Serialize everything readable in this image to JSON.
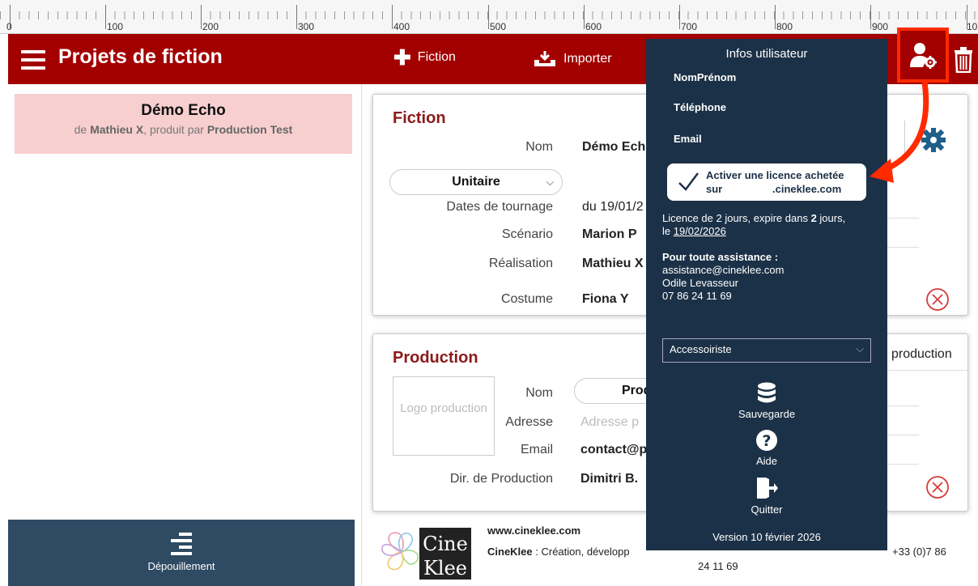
{
  "ruler": {
    "labels": [
      "0",
      "100",
      "200",
      "300",
      "400",
      "500",
      "600",
      "700",
      "800",
      "900",
      "10"
    ]
  },
  "topbar": {
    "title": "Projets de fiction",
    "fiction_label": "Fiction",
    "import_label": "Importer"
  },
  "project_list": [
    {
      "title": "Démo Echo",
      "prefix": "de ",
      "director": "Mathieu X",
      "mid": ", produit par ",
      "producer": "Production Test"
    }
  ],
  "bottom_nav": {
    "label": "Dépouillement"
  },
  "fiction": {
    "title": "Fiction",
    "nom_label": "Nom",
    "nom_value": "Démo Ech",
    "type_value": "Unitaire",
    "dates_label": "Dates de tournage",
    "dates_value": "du 19/01/2",
    "scenario_label": "Scénario",
    "scenario_value": "Marion P",
    "realisation_label": "Réalisation",
    "realisation_value": "Mathieu X",
    "costume_label": "Costume",
    "costume_value": "Fiona Y"
  },
  "production": {
    "title": "Production",
    "logo_placeholder": "Logo production",
    "nom_label": "Nom",
    "nom_value": "Prod",
    "adresse_label": "Adresse",
    "adresse_placeholder": "Adresse p",
    "email_label": "Email",
    "email_value": "contact@p",
    "dir_label": "Dir. de Production",
    "dir_value": "Dimitri B.",
    "side_label": "production"
  },
  "footer": {
    "url": "www.cineklee.com",
    "brand": "CineKlee",
    "desc": " : Création, développ",
    "phone_tail": "+33 (0)7 86",
    "phone_end": "24 11 69",
    "logo_top": "Cine",
    "logo_bottom": "Klee"
  },
  "user_menu": {
    "title": "Infos utilisateur",
    "name_label": "NomPrénom",
    "phone_label": "Téléphone",
    "email_label": "Email",
    "license_line1": "Activer une licence achetée",
    "license_line2a": "sur",
    "license_line2b": ".cineklee.com",
    "license_info_pre": "Licence de 2 jours, expire dans ",
    "license_days": "2",
    "license_info_post": " jours,",
    "license_date_pre": "le ",
    "license_date": "19/02/2026",
    "support_title": "Pour toute assistance :",
    "support_email": "assistance@cineklee.com",
    "support_name": "Odile Levasseur",
    "support_phone": "07 86 24 11 69",
    "role_value": "Accessoiriste",
    "save_label": "Sauvegarde",
    "help_label": "Aide",
    "quit_label": "Quitter",
    "version": "Version 10 février 2026"
  },
  "colors": {
    "brand_red": "#a30000",
    "highlight": "#ff2a00",
    "menu_bg": "#1b3147",
    "nav_bg": "#2f4b63"
  }
}
